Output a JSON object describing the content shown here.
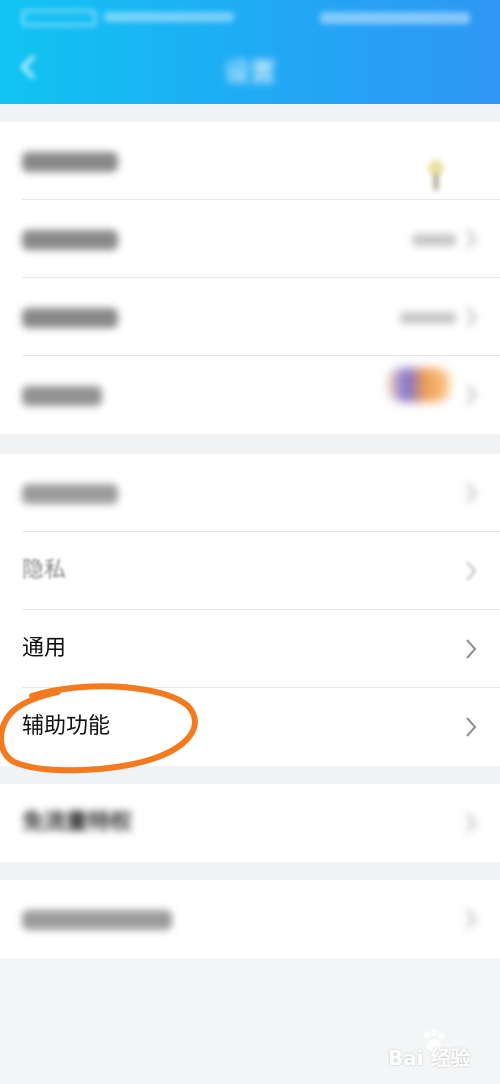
{
  "colors": {
    "header_start": "#10c4f2",
    "header_end": "#2f97f4",
    "annotation": "#f47a1f",
    "page_bg": "#f4f5f7"
  },
  "header": {
    "title": "设置",
    "back_icon": "chevron-left-icon"
  },
  "groups": [
    {
      "rows": [
        {
          "label": "",
          "value": ""
        },
        {
          "label": "",
          "value": ""
        },
        {
          "label": "",
          "value": ""
        },
        {
          "label": "",
          "value": ""
        }
      ]
    },
    {
      "rows": [
        {
          "label": ""
        },
        {
          "label": "隐私"
        },
        {
          "label": "通用"
        },
        {
          "label": "辅助功能"
        }
      ]
    },
    {
      "rows": [
        {
          "label": "免流量特权"
        }
      ]
    },
    {
      "rows": [
        {
          "label": ""
        }
      ]
    }
  ],
  "watermark": {
    "logo": "baidu-jingyan-logo",
    "text": "Bai 经验"
  }
}
